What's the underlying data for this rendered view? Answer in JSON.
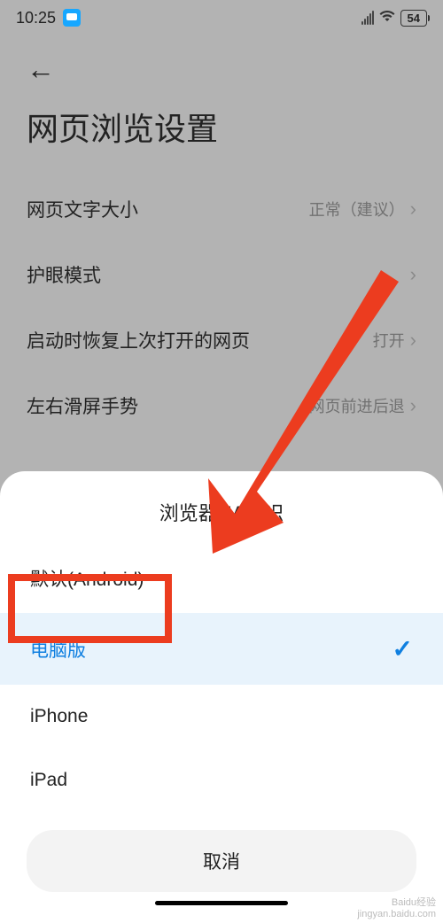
{
  "status": {
    "time": "10:25",
    "battery": "54"
  },
  "page": {
    "title": "网页浏览设置"
  },
  "settings": [
    {
      "label": "网页文字大小",
      "value": "正常（建议）"
    },
    {
      "label": "护眼模式",
      "value": ""
    },
    {
      "label": "启动时恢复上次打开的网页",
      "value": "打开"
    },
    {
      "label": "左右滑屏手势",
      "value": "网页前进后退"
    }
  ],
  "sheet": {
    "title": "浏览器UA标识",
    "options": [
      {
        "label": "默认(Android)",
        "selected": false
      },
      {
        "label": "电脑版",
        "selected": true
      },
      {
        "label": "iPhone",
        "selected": false
      },
      {
        "label": "iPad",
        "selected": false
      }
    ],
    "cancel": "取消"
  },
  "annotation": {
    "highlight_target": "电脑版",
    "arrow_color": "#ec3c1f"
  },
  "watermark": {
    "line1": "Baidu经验",
    "line2": "jingyan.baidu.com"
  }
}
